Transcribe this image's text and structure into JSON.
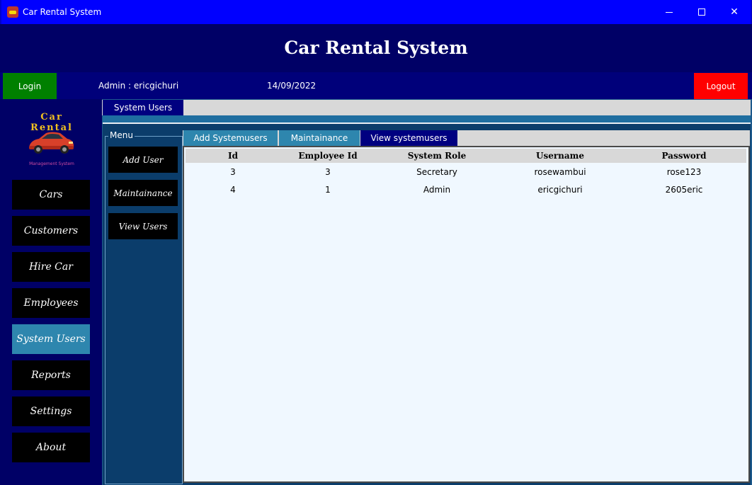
{
  "window": {
    "title": "Car Rental System"
  },
  "header": {
    "title": "Car Rental System"
  },
  "infobar": {
    "login_label": "Login",
    "admin_text": "Admin : ericgichuri",
    "date_text": "14/09/2022",
    "logout_label": "Logout"
  },
  "logo": {
    "title": "Car Rental",
    "subtitle": "Management System"
  },
  "sidebar": {
    "items": [
      {
        "label": "Cars"
      },
      {
        "label": "Customers"
      },
      {
        "label": "Hire Car"
      },
      {
        "label": "Employees"
      },
      {
        "label": "System Users",
        "active": true
      },
      {
        "label": "Reports"
      },
      {
        "label": "Settings"
      },
      {
        "label": "About"
      }
    ]
  },
  "outer_tabs": [
    {
      "label": "System Users"
    }
  ],
  "menu": {
    "legend": "Menu",
    "items": [
      {
        "label": "Add User"
      },
      {
        "label": "Maintainance"
      },
      {
        "label": "View Users"
      }
    ]
  },
  "inner_tabs": [
    {
      "label": "Add Systemusers"
    },
    {
      "label": "Maintainance"
    },
    {
      "label": "View systemusers",
      "active": true
    }
  ],
  "table": {
    "columns": [
      "Id",
      "Employee Id",
      "System Role",
      "Username",
      "Password"
    ],
    "rows": [
      [
        "3",
        "3",
        "Secretary",
        "rosewambui",
        "rose123"
      ],
      [
        "4",
        "1",
        "Admin",
        "ericgichuri",
        "2605eric"
      ]
    ]
  },
  "colors": {
    "titlebar": "#0000ff",
    "background": "#000066",
    "login": "#008000",
    "logout": "#ff0000",
    "active_nav": "#2e86ae",
    "nav_button": "#000000",
    "grid_bg": "#f0f8ff"
  }
}
